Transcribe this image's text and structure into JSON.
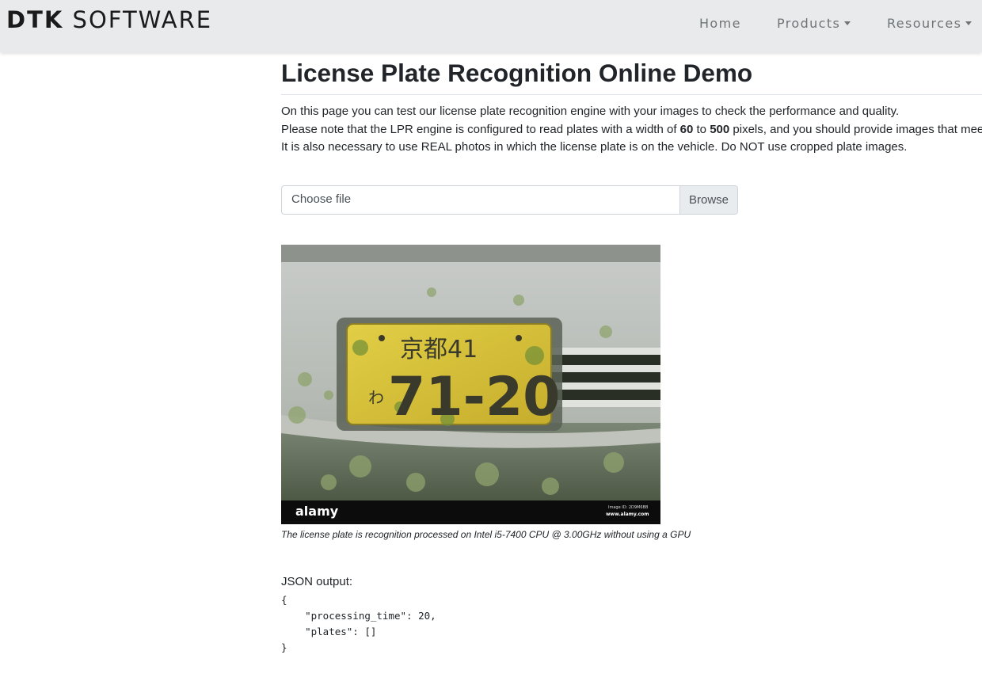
{
  "navbar": {
    "brand_bold": "DTK",
    "brand_light": "SOFTWARE",
    "items": [
      {
        "label": "Home",
        "dropdown": false
      },
      {
        "label": "Products",
        "dropdown": true
      },
      {
        "label": "Resources",
        "dropdown": true
      }
    ]
  },
  "page": {
    "title": "License Plate Recognition Online Demo",
    "line1": "On this page you can test our license plate recognition engine with your images to check the performance and quality.",
    "line2_pre": "Please note that the LPR engine is configured to read plates with a width of ",
    "line2_min": "60",
    "line2_mid": " to ",
    "line2_max": "500",
    "line2_post": " pixels, and you should provide images that meet this requirement.",
    "line3": "It is also necessary to use REAL photos in which the license plate is on the vehicle. Do NOT use cropped plate images."
  },
  "upload": {
    "placeholder": "Choose file",
    "browse_label": "Browse"
  },
  "result": {
    "plate_text_top": "京都41",
    "plate_text_bottom": "71-20",
    "plate_prefix": "わ",
    "watermark": "alamy",
    "watermark_small1": "Image ID: 2D9M6BB",
    "watermark_small2": "www.alamy.com",
    "caption": "The license plate is recognition processed on Intel i5-7400 CPU @ 3.00GHz without using a GPU",
    "json_label": "JSON output:",
    "json_text": "{\n    \"processing_time\": 20,\n    \"plates\": []\n}"
  },
  "colors": {
    "navbar_bg": "#e9eaec",
    "plate_yellow": "#d9c23a",
    "text": "#212529"
  }
}
